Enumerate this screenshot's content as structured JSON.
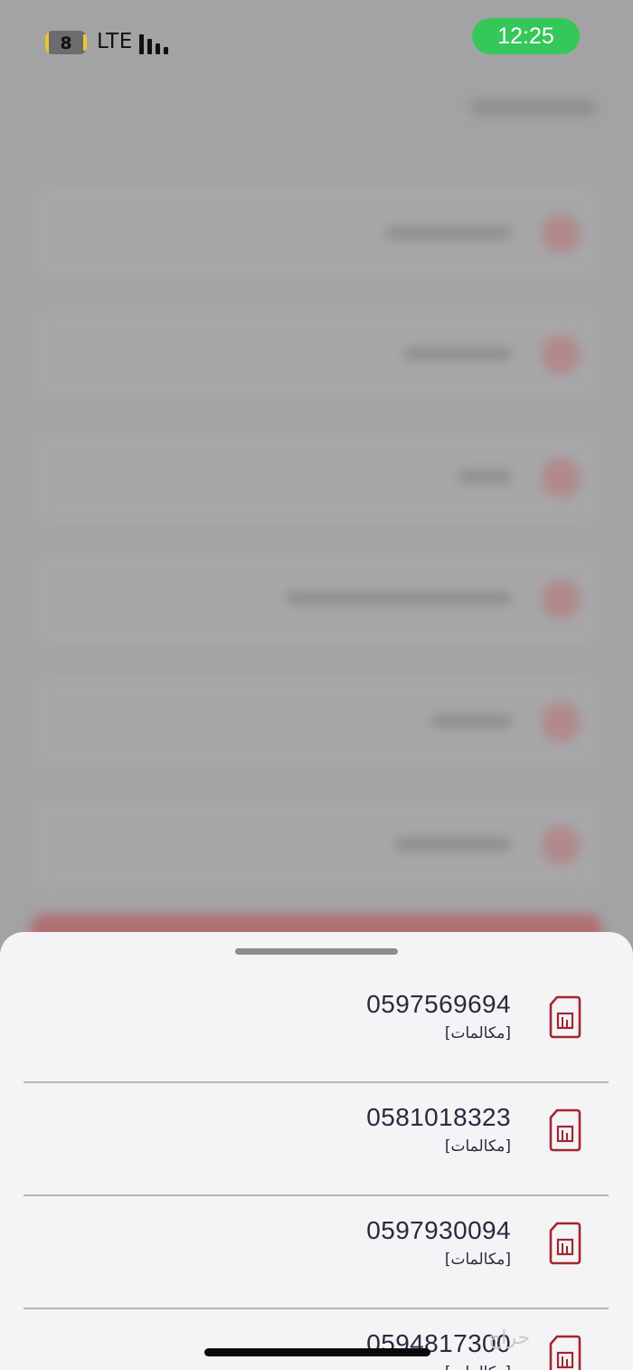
{
  "status_bar": {
    "battery_level": "8",
    "network": "LTE",
    "time": "12:25"
  },
  "sheet": {
    "lines": [
      {
        "number": "0597569694",
        "type": "[مكالمات]",
        "icon": "sim-card-icon"
      },
      {
        "number": "0581018323",
        "type": "[مكالمات]",
        "icon": "sim-card-icon"
      },
      {
        "number": "0597930094",
        "type": "[مكالمات]",
        "icon": "sim-card-icon"
      },
      {
        "number": "0594817300",
        "type": "[مكالمات]",
        "icon": "sim-card-icon"
      }
    ]
  },
  "watermark": "حراج",
  "colors": {
    "accent": "#a3262f",
    "time_pill": "#35c759",
    "text": "#2a2a3e"
  }
}
